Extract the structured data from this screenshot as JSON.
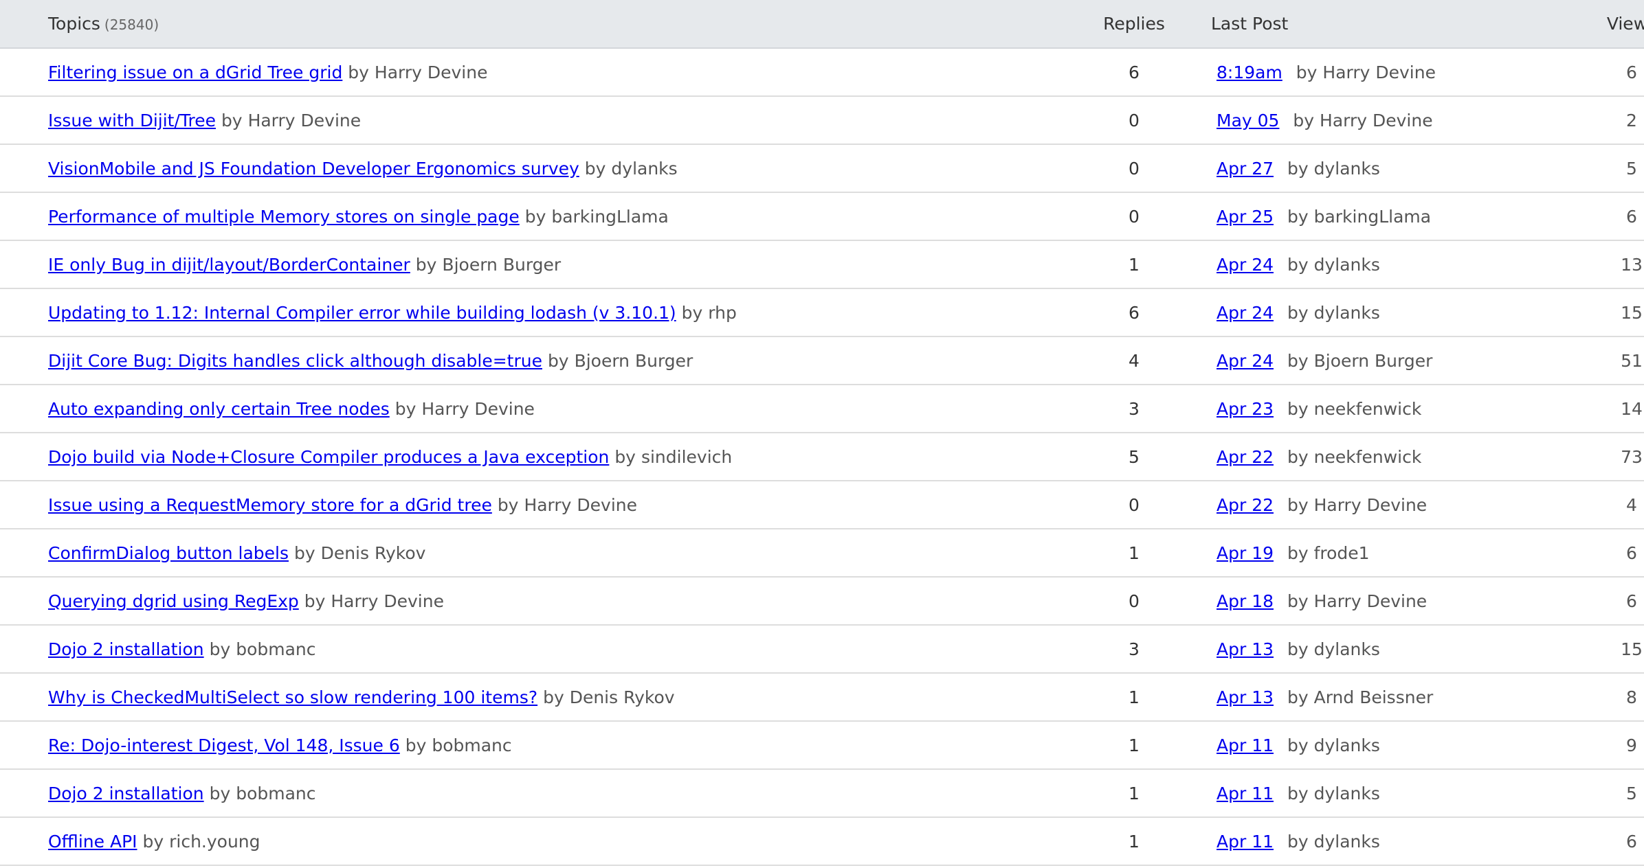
{
  "header": {
    "topics_label": "Topics",
    "topics_count": "(25840)",
    "replies_label": "Replies",
    "last_post_label": "Last Post",
    "views_label": "Views"
  },
  "by_prefix": "by",
  "rows": [
    {
      "title": "Filtering issue on a dGrid Tree grid",
      "author": "Harry Devine",
      "replies": "6",
      "last_time": "8:19am",
      "last_author": "Harry Devine",
      "views": "6"
    },
    {
      "title": "Issue with Dijit/Tree",
      "author": "Harry Devine",
      "replies": "0",
      "last_time": "May 05",
      "last_author": "Harry Devine",
      "views": "2"
    },
    {
      "title": "VisionMobile and JS Foundation Developer Ergonomics survey",
      "author": "dylanks",
      "replies": "0",
      "last_time": "Apr 27",
      "last_author": "dylanks",
      "views": "5"
    },
    {
      "title": "Performance of multiple Memory stores on single page",
      "author": "barkingLlama",
      "replies": "0",
      "last_time": "Apr 25",
      "last_author": "barkingLlama",
      "views": "6"
    },
    {
      "title": "IE only Bug in dijit/layout/BorderContainer",
      "author": "Bjoern Burger",
      "replies": "1",
      "last_time": "Apr 24",
      "last_author": "dylanks",
      "views": "13"
    },
    {
      "title": "Updating to 1.12: Internal Compiler error while building lodash (v 3.10.1)",
      "author": "rhp",
      "replies": "6",
      "last_time": "Apr 24",
      "last_author": "dylanks",
      "views": "15"
    },
    {
      "title": "Dijit Core Bug: Digits handles click although disable=true",
      "author": "Bjoern Burger",
      "replies": "4",
      "last_time": "Apr 24",
      "last_author": "Bjoern Burger",
      "views": "51"
    },
    {
      "title": "Auto expanding only certain Tree nodes",
      "author": "Harry Devine",
      "replies": "3",
      "last_time": "Apr 23",
      "last_author": "neekfenwick",
      "views": "14"
    },
    {
      "title": "Dojo build via Node+Closure Compiler produces a Java exception",
      "author": "sindilevich",
      "replies": "5",
      "last_time": "Apr 22",
      "last_author": "neekfenwick",
      "views": "73"
    },
    {
      "title": "Issue using a RequestMemory store for a dGrid tree",
      "author": "Harry Devine",
      "replies": "0",
      "last_time": "Apr 22",
      "last_author": "Harry Devine",
      "views": "4"
    },
    {
      "title": "ConfirmDialog button labels",
      "author": "Denis Rykov",
      "replies": "1",
      "last_time": "Apr 19",
      "last_author": "frode1",
      "views": "6"
    },
    {
      "title": "Querying dgrid using RegExp",
      "author": "Harry Devine",
      "replies": "0",
      "last_time": "Apr 18",
      "last_author": "Harry Devine",
      "views": "6"
    },
    {
      "title": "Dojo 2 installation",
      "author": "bobmanc",
      "replies": "3",
      "last_time": "Apr 13",
      "last_author": "dylanks",
      "views": "15"
    },
    {
      "title": "Why is CheckedMultiSelect so slow rendering 100 items?",
      "author": "Denis Rykov",
      "replies": "1",
      "last_time": "Apr 13",
      "last_author": "Arnd Beissner",
      "views": "8"
    },
    {
      "title": "Re: Dojo-interest Digest, Vol 148, Issue 6",
      "author": "bobmanc",
      "replies": "1",
      "last_time": "Apr 11",
      "last_author": "dylanks",
      "views": "9"
    },
    {
      "title": "Dojo 2 installation",
      "author": "bobmanc",
      "replies": "1",
      "last_time": "Apr 11",
      "last_author": "dylanks",
      "views": "5"
    },
    {
      "title": "Offline API",
      "author": "rich.young",
      "replies": "1",
      "last_time": "Apr 11",
      "last_author": "dylanks",
      "views": "6"
    }
  ]
}
